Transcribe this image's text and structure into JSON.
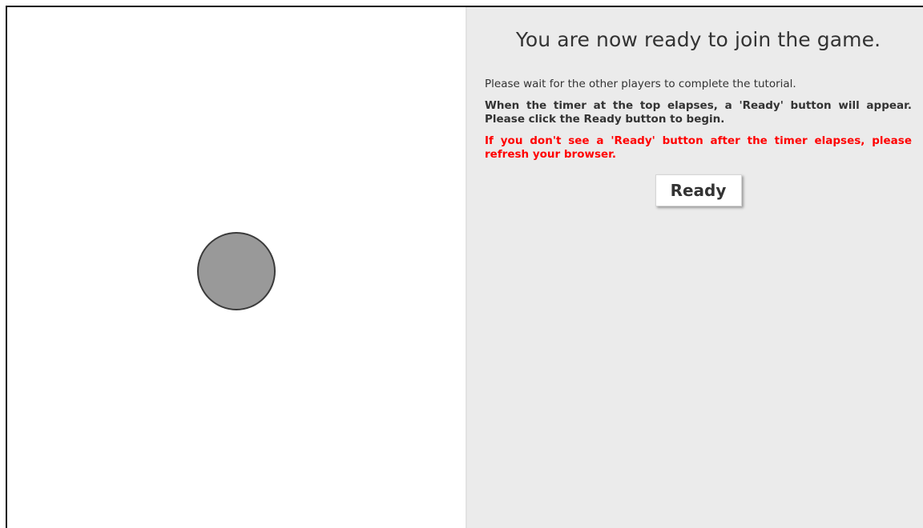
{
  "panel": {
    "title": "You are now ready to join the game.",
    "info": "Please wait for the other players to complete the tutorial.",
    "instruction": "When the timer at the top elapses, a 'Ready' button will appear. Please click the Ready button to begin.",
    "warning": "If you don't see a 'Ready' button after the timer elapses, please refresh your browser.",
    "ready_label": "Ready"
  },
  "colors": {
    "panel_background": "#ebebeb",
    "warning": "#ff0000",
    "circle_fill": "#999999",
    "circle_stroke": "#3a3a3a"
  }
}
